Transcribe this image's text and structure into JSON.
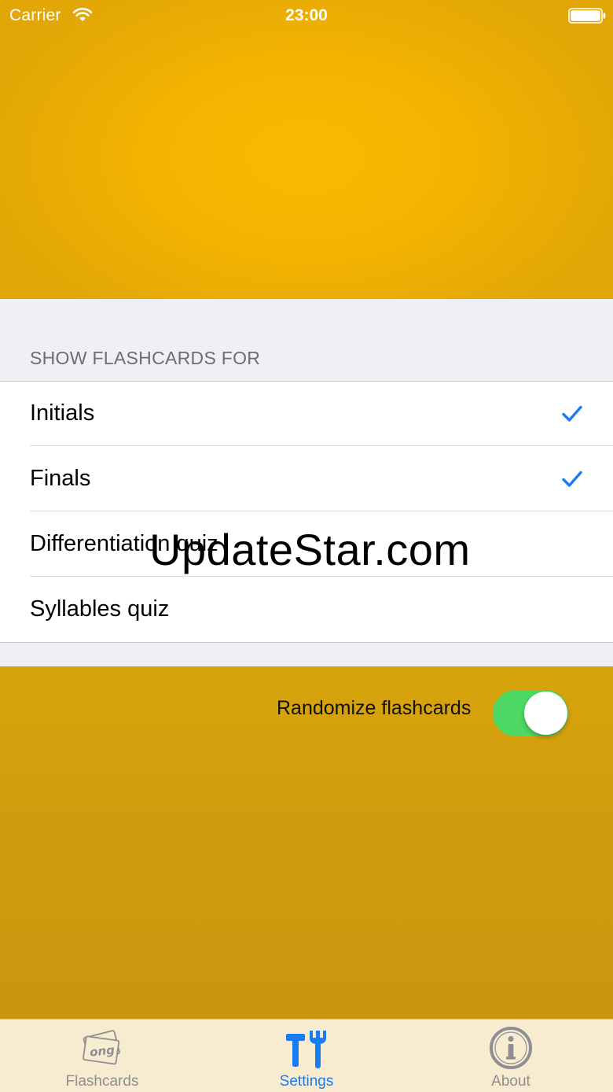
{
  "status_bar": {
    "carrier": "Carrier",
    "time": "23:00"
  },
  "settings": {
    "section_header": "SHOW FLASHCARDS FOR",
    "rows": [
      {
        "label": "Initials",
        "checked": true
      },
      {
        "label": "Finals",
        "checked": true
      },
      {
        "label": "Differentiation quiz",
        "checked": false
      },
      {
        "label": "Syllables quiz",
        "checked": false
      }
    ],
    "randomize_label": "Randomize flashcards",
    "randomize_on": true
  },
  "watermark": "UpdateStar.com",
  "tab_bar": {
    "tabs": [
      {
        "label": "Flashcards",
        "icon": "flashcards-icon",
        "icon_text": "ong",
        "active": false
      },
      {
        "label": "Settings",
        "icon": "tools-icon",
        "active": true
      },
      {
        "label": "About",
        "icon": "info-icon",
        "active": false
      }
    ]
  },
  "colors": {
    "accent_blue": "#1a7cf2",
    "toggle_green": "#4cd964",
    "gold": "#f6b400"
  }
}
